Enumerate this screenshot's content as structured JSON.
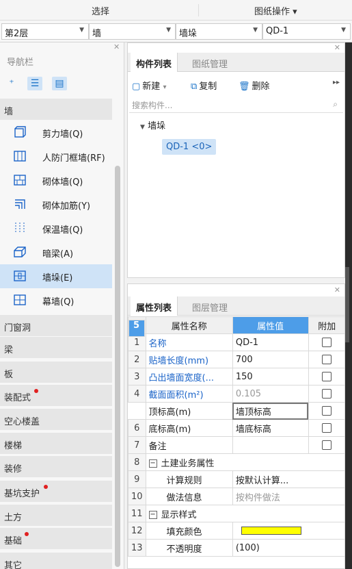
{
  "menubar": {
    "select_label": "选择",
    "drawing_ops_label": "图纸操作 ▾"
  },
  "selectors": [
    {
      "value": "第2层"
    },
    {
      "value": "墙"
    },
    {
      "value": "墙垛"
    },
    {
      "value": "QD-1"
    }
  ],
  "nav": {
    "title": "导航栏",
    "groups_top": [
      {
        "label": "墙"
      }
    ],
    "items": [
      {
        "label": "剪力墙(Q)",
        "icon": "shear-wall-icon"
      },
      {
        "label": "人防门框墙(RF)",
        "icon": "civil-defense-door-wall-icon"
      },
      {
        "label": "砌体墙(Q)",
        "icon": "masonry-wall-icon"
      },
      {
        "label": "砌体加筋(Y)",
        "icon": "masonry-rebar-icon"
      },
      {
        "label": "保温墙(Q)",
        "icon": "insulation-wall-icon"
      },
      {
        "label": "暗梁(A)",
        "icon": "hidden-beam-icon"
      },
      {
        "label": "墙垛(E)",
        "icon": "wall-pier-icon",
        "selected": true
      },
      {
        "label": "幕墙(Q)",
        "icon": "curtain-wall-icon"
      }
    ],
    "groups": [
      {
        "label": "门窗洞",
        "dot": false
      },
      {
        "label": "梁",
        "dot": false
      },
      {
        "label": "板",
        "dot": false
      },
      {
        "label": "装配式",
        "dot": true
      },
      {
        "label": "空心楼盖",
        "dot": false
      },
      {
        "label": "楼梯",
        "dot": false
      },
      {
        "label": "装修",
        "dot": false
      },
      {
        "label": "基坑支护",
        "dot": true
      },
      {
        "label": "土方",
        "dot": false
      },
      {
        "label": "基础",
        "dot": true
      },
      {
        "label": "其它",
        "dot": false
      }
    ]
  },
  "component_panel": {
    "tabs": [
      "构件列表",
      "图纸管理"
    ],
    "toolbar": {
      "new_label": "新建",
      "copy_label": "复制",
      "delete_label": "删除"
    },
    "search_placeholder": "搜索构件...",
    "tree": {
      "root": "墙垛",
      "leaf": "QD-1 <0>"
    }
  },
  "property_panel": {
    "tabs": [
      "属性列表",
      "图层管理"
    ],
    "headers": {
      "name": "属性名称",
      "value": "属性值",
      "extra": "附加"
    },
    "rows": [
      {
        "num": "1",
        "name": "名称",
        "value": "QD-1"
      },
      {
        "num": "2",
        "name": "贴墙长度(mm)",
        "value": "700"
      },
      {
        "num": "3",
        "name": "凸出墙面宽度(...",
        "value": "150"
      },
      {
        "num": "4",
        "name": "截面面积(m²)",
        "value": "0.105"
      },
      {
        "num": "5",
        "name": "顶标高(m)",
        "value": "墙顶标高"
      },
      {
        "num": "6",
        "name": "底标高(m)",
        "value": "墙底标高"
      },
      {
        "num": "7",
        "name": "备注",
        "value": ""
      },
      {
        "num": "8",
        "name": "土建业务属性",
        "value": ""
      },
      {
        "num": "9",
        "name": "计算规则",
        "value": "按默认计算..."
      },
      {
        "num": "10",
        "name": "做法信息",
        "value": "按构件做法"
      },
      {
        "num": "11",
        "name": "显示样式",
        "value": ""
      },
      {
        "num": "12",
        "name": "填充颜色",
        "value": ""
      },
      {
        "num": "13",
        "name": "不透明度",
        "value": "(100)"
      }
    ],
    "fill_color": "#ffff00"
  },
  "colors": {
    "accent": "#4d9de8",
    "selected_bg": "#cfe3f7",
    "link_blue": "#1a63c8",
    "dot_red": "#e02020"
  }
}
